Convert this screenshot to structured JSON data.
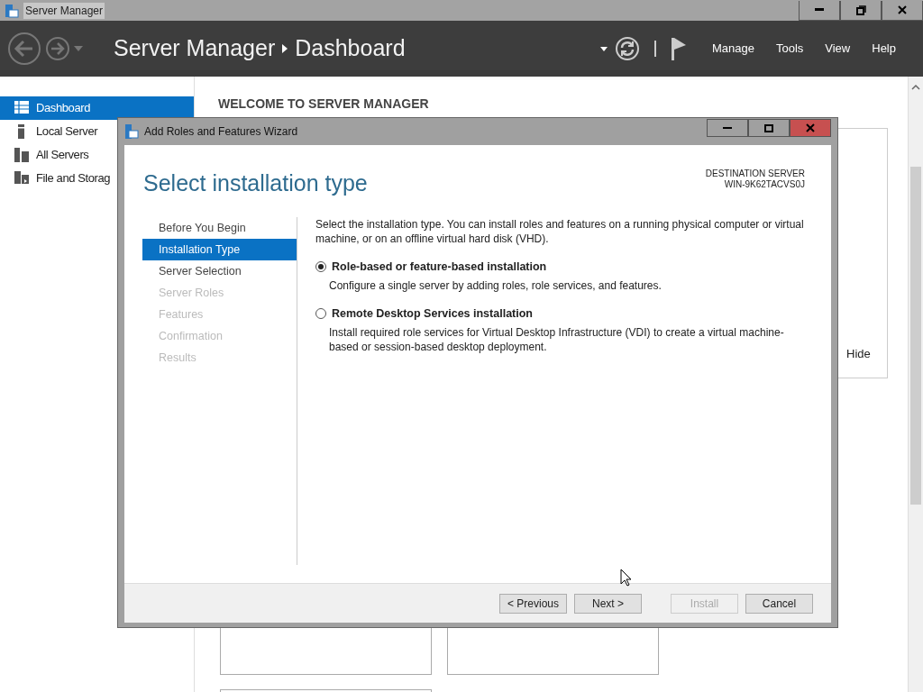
{
  "window": {
    "title": "Server Manager",
    "title_selected": true
  },
  "header": {
    "breadcrumb": [
      "Server Manager",
      "Dashboard"
    ],
    "menus": [
      "Manage",
      "Tools",
      "View",
      "Help"
    ]
  },
  "sidebar": {
    "items": [
      {
        "label": "Dashboard",
        "selected": true
      },
      {
        "label": "Local Server",
        "selected": false
      },
      {
        "label": "All Servers",
        "selected": false
      },
      {
        "label": "File and Storag",
        "selected": false
      }
    ]
  },
  "main": {
    "heading": "WELCOME TO SERVER MANAGER",
    "hide_link": "Hide"
  },
  "wizard": {
    "title": "Add Roles and Features Wizard",
    "heading": "Select installation type",
    "destination_label": "DESTINATION SERVER",
    "destination_server": "WIN-9K62TACVS0J",
    "steps": [
      {
        "label": "Before You Begin",
        "selected": false,
        "disabled": false
      },
      {
        "label": "Installation Type",
        "selected": true,
        "disabled": false
      },
      {
        "label": "Server Selection",
        "selected": false,
        "disabled": false
      },
      {
        "label": "Server Roles",
        "selected": false,
        "disabled": true
      },
      {
        "label": "Features",
        "selected": false,
        "disabled": true
      },
      {
        "label": "Confirmation",
        "selected": false,
        "disabled": true
      },
      {
        "label": "Results",
        "selected": false,
        "disabled": true
      }
    ],
    "intro": "Select the installation type. You can install roles and features on a running physical computer or virtual machine, or on an offline virtual hard disk (VHD).",
    "options": [
      {
        "title": "Role-based or feature-based installation",
        "description": "Configure a single server by adding roles, role services, and features.",
        "selected": true
      },
      {
        "title": "Remote Desktop Services installation",
        "description": "Install required role services for Virtual Desktop Infrastructure (VDI) to create a virtual machine-based or session-based desktop deployment.",
        "selected": false
      }
    ],
    "buttons": [
      {
        "label": "< Previous",
        "disabled": false
      },
      {
        "label": "Next >",
        "disabled": false
      },
      {
        "label": "Install",
        "disabled": true
      },
      {
        "label": "Cancel",
        "disabled": false
      }
    ]
  }
}
